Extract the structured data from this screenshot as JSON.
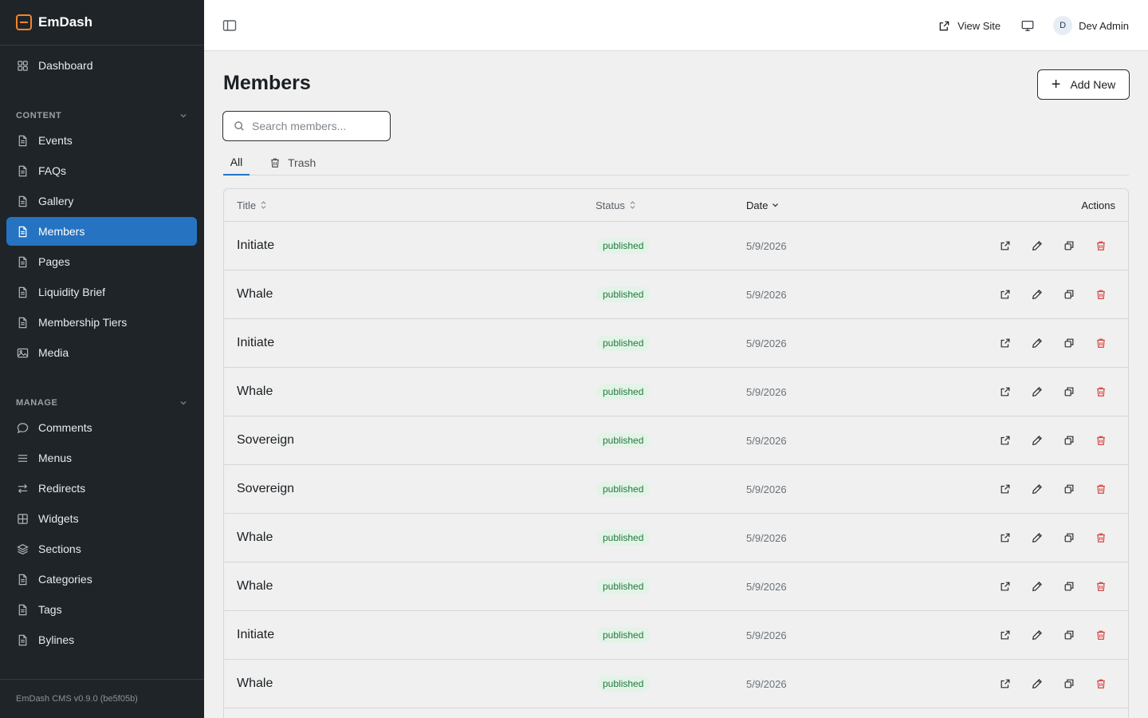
{
  "app": {
    "name": "EmDash",
    "version_text": "EmDash CMS v0.9.0 (be5f05b)"
  },
  "sidebar": {
    "dashboard": {
      "label": "Dashboard",
      "icon": "grid-icon"
    },
    "content_section": "CONTENT",
    "content_items": [
      {
        "label": "Events",
        "icon": "file-icon",
        "active": false
      },
      {
        "label": "FAQs",
        "icon": "file-icon",
        "active": false
      },
      {
        "label": "Gallery",
        "icon": "file-icon",
        "active": false
      },
      {
        "label": "Members",
        "icon": "file-icon",
        "active": true
      },
      {
        "label": "Pages",
        "icon": "file-icon",
        "active": false
      },
      {
        "label": "Liquidity Brief",
        "icon": "file-icon",
        "active": false
      },
      {
        "label": "Membership Tiers",
        "icon": "file-icon",
        "active": false
      },
      {
        "label": "Media",
        "icon": "image-icon",
        "active": false
      }
    ],
    "manage_section": "MANAGE",
    "manage_items": [
      {
        "label": "Comments",
        "icon": "comment-icon"
      },
      {
        "label": "Menus",
        "icon": "menu-icon"
      },
      {
        "label": "Redirects",
        "icon": "redirect-icon"
      },
      {
        "label": "Widgets",
        "icon": "widgets-icon"
      },
      {
        "label": "Sections",
        "icon": "layers-icon"
      },
      {
        "label": "Categories",
        "icon": "file-icon"
      },
      {
        "label": "Tags",
        "icon": "file-icon"
      },
      {
        "label": "Bylines",
        "icon": "file-icon"
      }
    ]
  },
  "topbar": {
    "view_site": "View Site",
    "user": {
      "initial": "D",
      "name": "Dev Admin"
    }
  },
  "page": {
    "title": "Members",
    "add_new": "Add New",
    "search_placeholder": "Search members...",
    "tabs": {
      "all": "All",
      "trash": "Trash"
    }
  },
  "table": {
    "headers": {
      "title": "Title",
      "status": "Status",
      "date": "Date",
      "actions": "Actions"
    },
    "rows": [
      {
        "title": "Initiate",
        "status": "published",
        "date": "5/9/2026"
      },
      {
        "title": "Whale",
        "status": "published",
        "date": "5/9/2026"
      },
      {
        "title": "Initiate",
        "status": "published",
        "date": "5/9/2026"
      },
      {
        "title": "Whale",
        "status": "published",
        "date": "5/9/2026"
      },
      {
        "title": "Sovereign",
        "status": "published",
        "date": "5/9/2026"
      },
      {
        "title": "Sovereign",
        "status": "published",
        "date": "5/9/2026"
      },
      {
        "title": "Whale",
        "status": "published",
        "date": "5/9/2026"
      },
      {
        "title": "Whale",
        "status": "published",
        "date": "5/9/2026"
      },
      {
        "title": "Initiate",
        "status": "published",
        "date": "5/9/2026"
      },
      {
        "title": "Whale",
        "status": "published",
        "date": "5/9/2026"
      }
    ]
  },
  "colors": {
    "sidebar_bg": "#1f2429",
    "active_nav": "#2673c2",
    "brand_accent": "#f0862b",
    "badge_bg": "#e4f3e8",
    "badge_text": "#217a3c",
    "delete": "#d5443f"
  }
}
